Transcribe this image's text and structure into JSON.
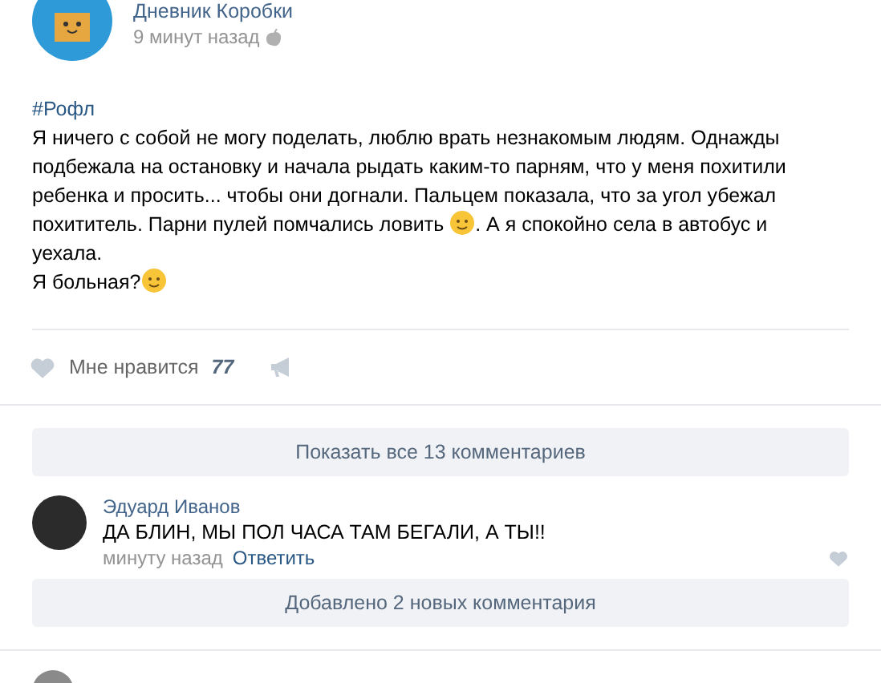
{
  "post": {
    "author": "Дневник Коробки",
    "time": "9 минут назад",
    "hashtag": "#Рофл",
    "body": [
      {
        "kind": "text",
        "text": "Я ничего с собой не могу поделать, люблю врать незнакомым людям. Однажды подбежала на остановку и начала рыдать каким-то парням, что у меня похитили ребенка и просить... чтобы они догнали. Пальцем показала, что за угол убежал похититель. Парни пулей помчались ловить "
      },
      {
        "kind": "emoji"
      },
      {
        "kind": "text",
        "text": ". А я спокойно села в автобус и уехала."
      },
      {
        "kind": "break"
      },
      {
        "kind": "text",
        "text": "Я больная?"
      },
      {
        "kind": "emoji"
      }
    ],
    "like_label": "Мне нравится",
    "like_count": "77"
  },
  "show_all": "Показать все 13 комментариев",
  "comments": [
    {
      "author": "Эдуард Иванов",
      "text": "ДА БЛИН, МЫ ПОЛ ЧАСА ТАМ БЕГАЛИ, А ТЫ!!",
      "time": "минуту назад",
      "reply": "Ответить"
    }
  ],
  "new_comments": "Добавлено 2 новых комментария"
}
